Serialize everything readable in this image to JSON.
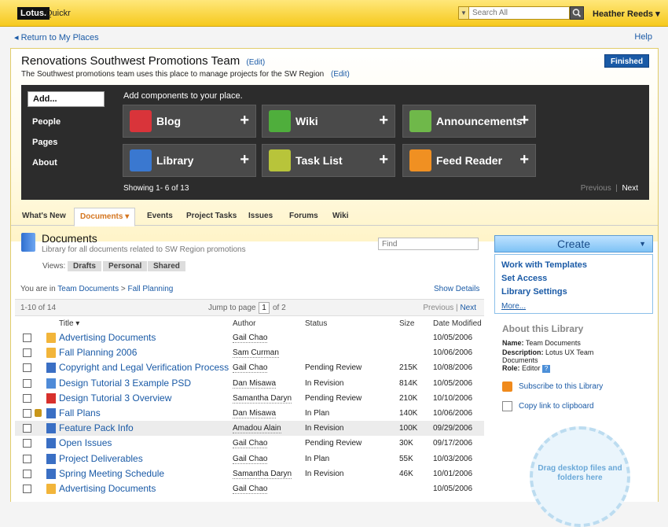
{
  "topbar": {
    "logo": "Lotus.",
    "product": "Quickr",
    "search_placeholder": "Search All",
    "user": "Heather Reeds ▾"
  },
  "subbar": {
    "return_link": "◂ Return to My Places",
    "help": "Help"
  },
  "place": {
    "title": "Renovations Southwest Promotions Team",
    "title_edit": "(Edit)",
    "description": "The Southwest promotions team uses this place to manage projects for the SW Region",
    "description_edit": "(Edit)",
    "finished_button": "Finished"
  },
  "addnav": [
    "Add...",
    "People",
    "Pages",
    "About"
  ],
  "components": {
    "header": "Add components to your place.",
    "tiles": [
      {
        "label": "Blog",
        "color": "#d9343a"
      },
      {
        "label": "Wiki",
        "color": "#4fae3c"
      },
      {
        "label": "Announcements",
        "color": "#6fb84a"
      },
      {
        "label": "Library",
        "color": "#3a78d0"
      },
      {
        "label": "Task List",
        "color": "#b8c43a"
      },
      {
        "label": "Feed Reader",
        "color": "#f09022"
      }
    ],
    "showing": "Showing 1- 6 of 13",
    "previous": "Previous",
    "sep": "|",
    "next": "Next"
  },
  "tabs": [
    "What's New",
    "Documents ▾",
    "Events",
    "Project Tasks",
    "Issues",
    "Forums",
    "Wiki"
  ],
  "library": {
    "title": "Documents",
    "subtitle": "Library for all documents related to SW Region promotions",
    "find_placeholder": "Find",
    "views_label": "Views:",
    "views": [
      "Drafts",
      "Personal",
      "Shared"
    ],
    "crumb_prefix": "You are in",
    "crumb_link1": "Team Documents",
    "crumb_sep": ">",
    "crumb_link2": "Fall Planning",
    "show_details": "Show Details",
    "pager": {
      "count": "1-10 of 14",
      "jump": "Jump to page",
      "page": "1",
      "of": "of 2",
      "previous": "Previous",
      "sep": "|",
      "next": "Next"
    },
    "columns": [
      "Title ▾",
      "Author",
      "Status",
      "Size",
      "Date Modified"
    ],
    "rows": [
      {
        "name": "Advertising Documents",
        "author": "Gail Chao",
        "status": "",
        "size": "",
        "date": "10/05/2006",
        "icon": "folder"
      },
      {
        "name": "Fall Planning 2006",
        "author": "Sam Curman",
        "status": "",
        "size": "",
        "date": "10/06/2006",
        "icon": "folder"
      },
      {
        "name": "Copyright and Legal Verification Process",
        "author": "Gail Chao",
        "status": "Pending Review",
        "size": "215K",
        "date": "10/08/2006",
        "icon": "doc"
      },
      {
        "name": "Design Tutorial 3 Example PSD",
        "author": "Dan Misawa",
        "status": "In Revision",
        "size": "814K",
        "date": "10/05/2006",
        "icon": "img"
      },
      {
        "name": "Design Tutorial 3 Overview",
        "author": "Samantha Daryn",
        "status": "Pending Review",
        "size": "210K",
        "date": "10/10/2006",
        "icon": "pdf"
      },
      {
        "name": "Fall Plans",
        "author": "Dan Misawa",
        "status": "In Plan",
        "size": "140K",
        "date": "10/06/2006",
        "icon": "doc"
      },
      {
        "name": "Feature Pack Info",
        "author": "Amadou Alain",
        "status": "In Revision",
        "size": "100K",
        "date": "09/29/2006",
        "icon": "doc"
      },
      {
        "name": "Open Issues",
        "author": "Gail Chao",
        "status": "Pending Review",
        "size": "30K",
        "date": "09/17/2006",
        "icon": "doc"
      },
      {
        "name": "Project Deliverables",
        "author": "Gail Chao",
        "status": "In Plan",
        "size": "55K",
        "date": "10/03/2006",
        "icon": "doc"
      },
      {
        "name": "Spring Meeting Schedule",
        "author": "Samantha Daryn",
        "status": "In Revision",
        "size": "46K",
        "date": "10/01/2006",
        "icon": "doc"
      },
      {
        "name": "Advertising Documents",
        "author": "Gail Chao",
        "status": "",
        "size": "",
        "date": "10/05/2006",
        "icon": "folder"
      }
    ]
  },
  "right": {
    "create": "Create",
    "create_arrow": "▼",
    "menu": [
      "Work with Templates",
      "Set Access",
      "Library Settings"
    ],
    "more": "More...",
    "about_title": "About this Library",
    "name_label": "Name:",
    "name_value": "Team Documents",
    "desc_label": "Description:",
    "desc_value": "Lotus UX Team Documents",
    "role_label": "Role:",
    "role_value": "Editor",
    "role_help": "?",
    "subscribe": "Subscribe to this Library",
    "copy_link": "Copy link to clipboard",
    "dropzone": "Drag desktop files and folders here"
  }
}
